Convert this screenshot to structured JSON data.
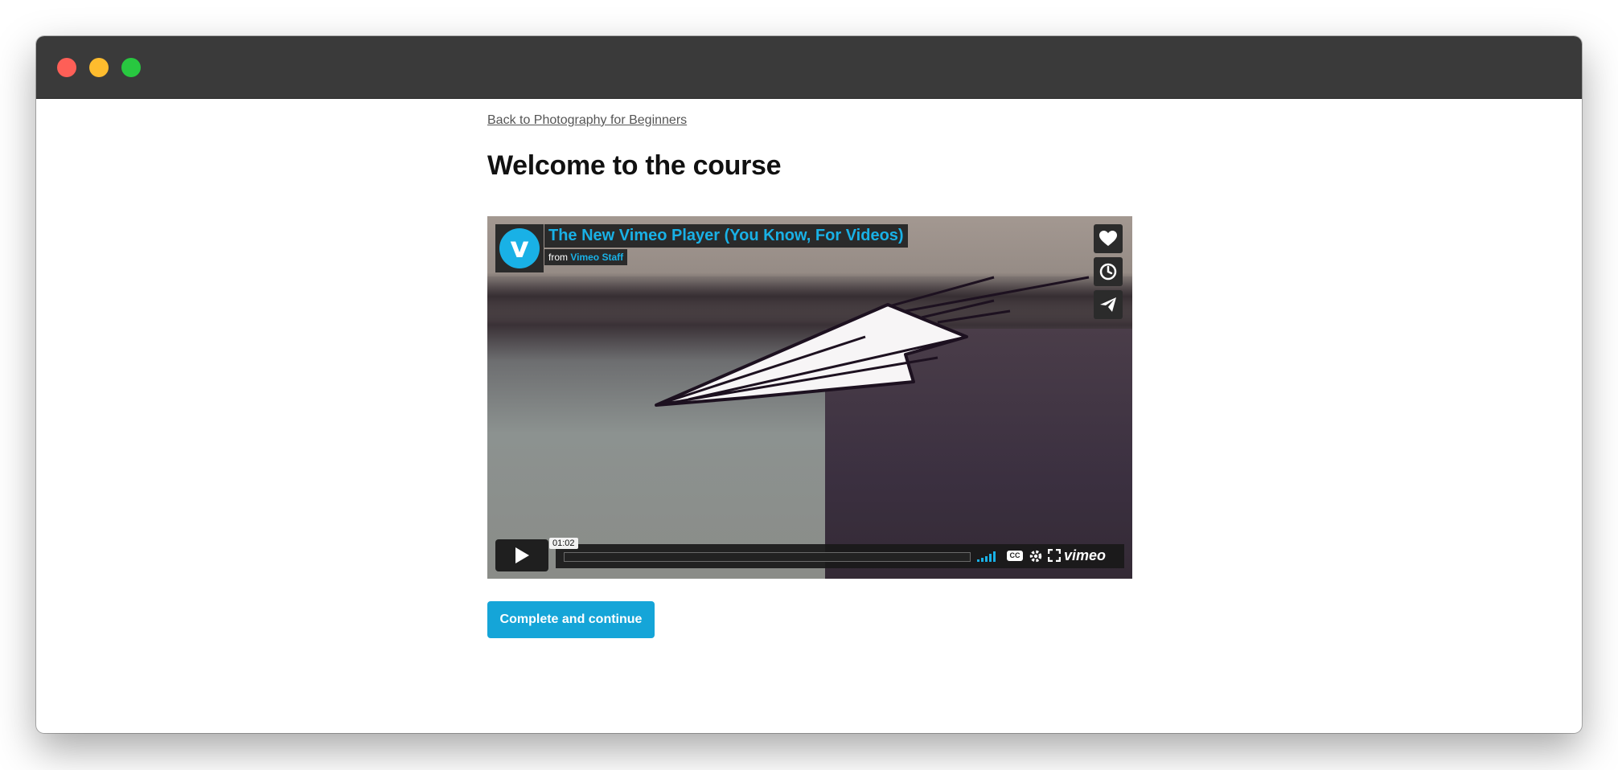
{
  "window": {
    "traffic_lights": [
      "close",
      "minimize",
      "zoom"
    ]
  },
  "page": {
    "back_link": "Back to Photography for Beginners",
    "title": "Welcome to the course",
    "cta_label": "Complete and continue"
  },
  "video": {
    "title": "The New Vimeo Player (You Know, For Videos)",
    "byline_prefix": "from",
    "author": "Vimeo Staff",
    "duration": "01:02",
    "progress_fraction": 0.0,
    "cc_label": "CC",
    "logo_text": "vimeo",
    "avatar_letter": "v",
    "icons": [
      "heart-icon",
      "clock-icon",
      "paper-plane-icon",
      "play-icon",
      "volume-icon",
      "captions-icon",
      "gear-icon",
      "fullscreen-icon"
    ]
  },
  "colors": {
    "accent": "#19b1e6",
    "button": "#15a5d8",
    "titlebar": "#3a3a3a"
  }
}
